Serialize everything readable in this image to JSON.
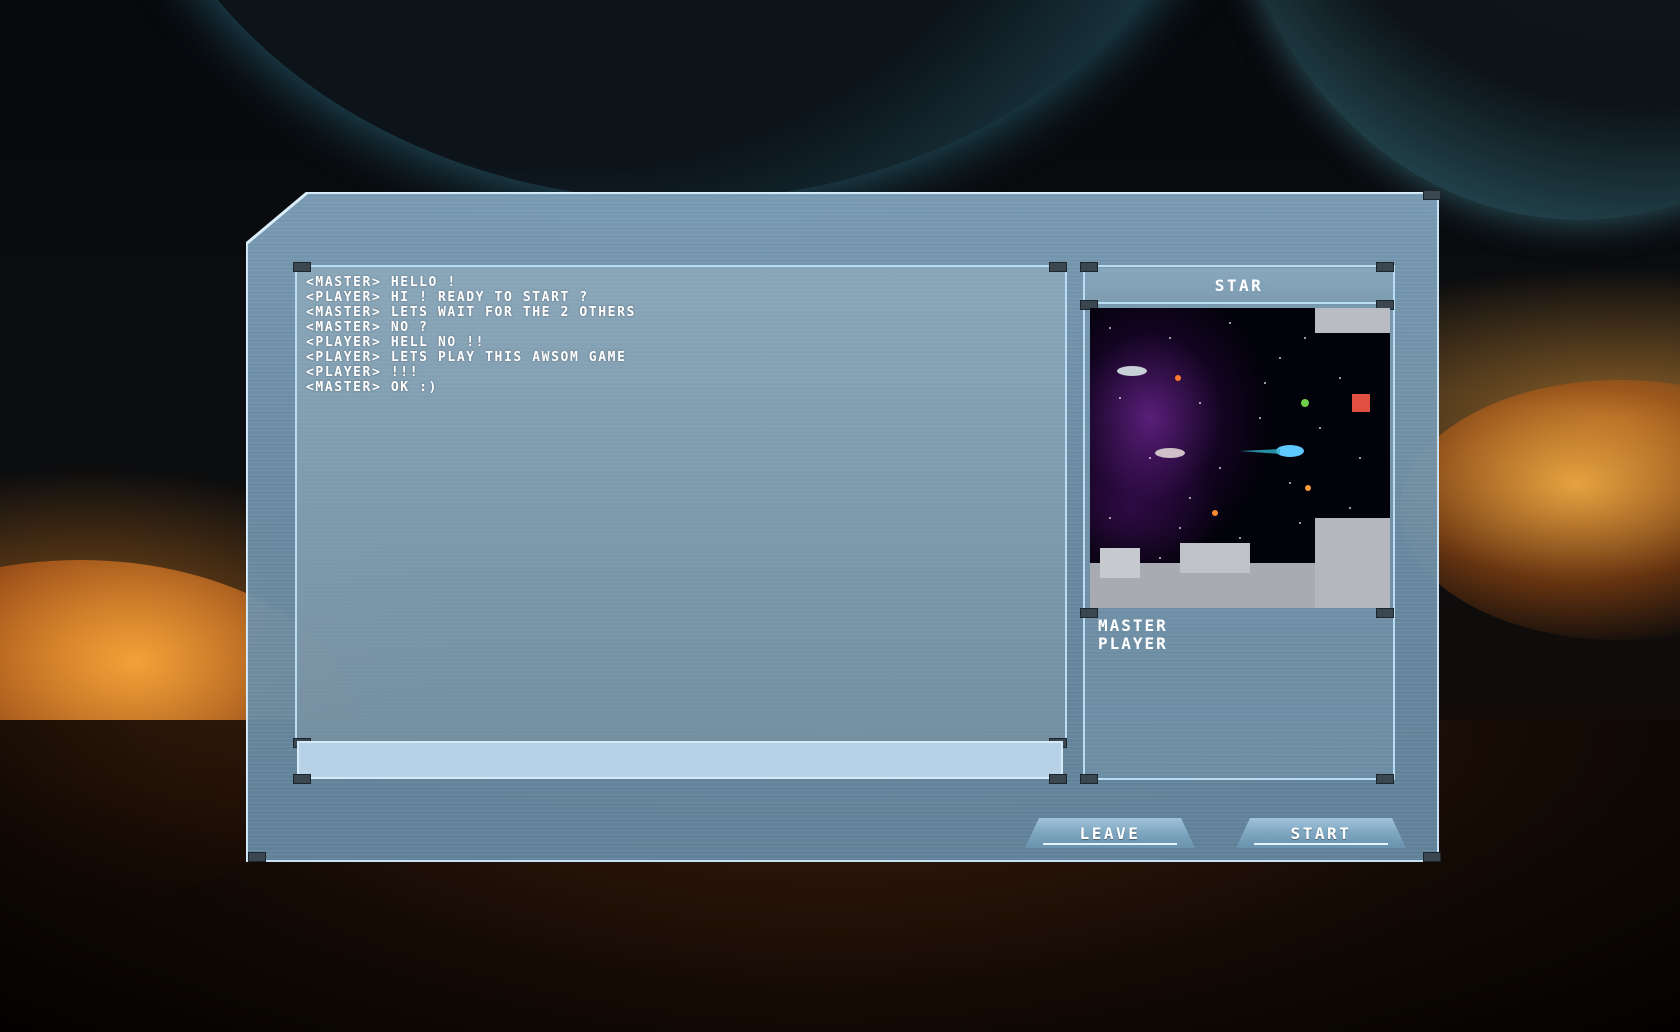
{
  "lobby": {
    "chat": {
      "messages": [
        "<MASTER> HELLO !",
        "<PLAYER> HI ! READY TO START ?",
        "<MASTER> LETS WAIT FOR THE 2 OTHERS",
        "<MASTER> NO ?",
        "<PLAYER> HELL NO !!",
        "<PLAYER> LETS PLAY THIS AWSOM GAME",
        "<PLAYER> !!!",
        "<MASTER> OK :)"
      ],
      "input_value": ""
    },
    "room": {
      "title": "STAR",
      "map_preview": "space-shooter-level-preview",
      "players": [
        "MASTER",
        "PLAYER"
      ]
    },
    "buttons": {
      "leave": "LEAVE",
      "start": "START"
    }
  },
  "colors": {
    "frame_border": "#c8e2f5",
    "panel_fill": "#7fa2bb",
    "text": "#ffffff",
    "input_fill": "#b7d1e6"
  }
}
